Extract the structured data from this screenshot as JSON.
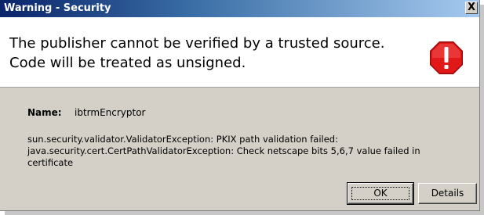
{
  "window": {
    "title": "Warning - Security",
    "close_glyph": "X"
  },
  "header": {
    "line1": "The publisher cannot be verified by a trusted source.",
    "line2": "Code will be treated as unsigned.",
    "icon": "warning-octagon-icon",
    "icon_glyph": "!",
    "icon_color": "#e01818"
  },
  "details": {
    "name_label": "Name:",
    "name_value": "ibtrmEncryptor",
    "message_line1": "sun.security.validator.ValidatorException: PKIX path validation failed:",
    "message_line2": "java.security.cert.CertPathValidatorException: Check netscape bits 5,6,7 value failed in",
    "message_line3": "certificate"
  },
  "buttons": {
    "ok_label": "OK",
    "details_label": "Details"
  }
}
